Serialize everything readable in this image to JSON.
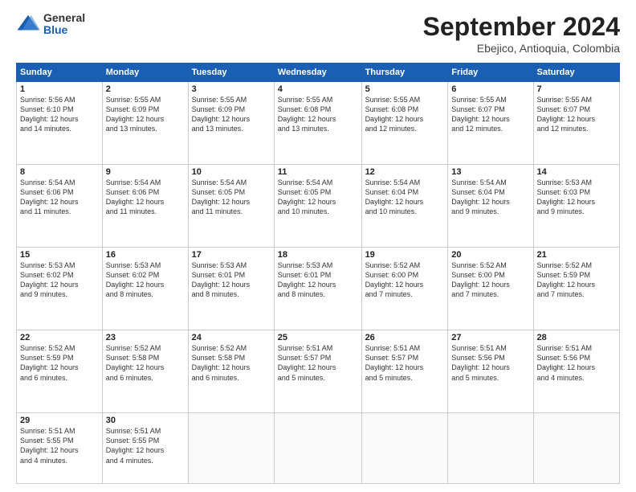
{
  "logo": {
    "general": "General",
    "blue": "Blue"
  },
  "header": {
    "month": "September 2024",
    "location": "Ebejico, Antioquia, Colombia"
  },
  "weekdays": [
    "Sunday",
    "Monday",
    "Tuesday",
    "Wednesday",
    "Thursday",
    "Friday",
    "Saturday"
  ],
  "weeks": [
    [
      {
        "day": "1",
        "info": "Sunrise: 5:56 AM\nSunset: 6:10 PM\nDaylight: 12 hours\nand 14 minutes."
      },
      {
        "day": "2",
        "info": "Sunrise: 5:55 AM\nSunset: 6:09 PM\nDaylight: 12 hours\nand 13 minutes."
      },
      {
        "day": "3",
        "info": "Sunrise: 5:55 AM\nSunset: 6:09 PM\nDaylight: 12 hours\nand 13 minutes."
      },
      {
        "day": "4",
        "info": "Sunrise: 5:55 AM\nSunset: 6:08 PM\nDaylight: 12 hours\nand 13 minutes."
      },
      {
        "day": "5",
        "info": "Sunrise: 5:55 AM\nSunset: 6:08 PM\nDaylight: 12 hours\nand 12 minutes."
      },
      {
        "day": "6",
        "info": "Sunrise: 5:55 AM\nSunset: 6:07 PM\nDaylight: 12 hours\nand 12 minutes."
      },
      {
        "day": "7",
        "info": "Sunrise: 5:55 AM\nSunset: 6:07 PM\nDaylight: 12 hours\nand 12 minutes."
      }
    ],
    [
      {
        "day": "8",
        "info": "Sunrise: 5:54 AM\nSunset: 6:06 PM\nDaylight: 12 hours\nand 11 minutes."
      },
      {
        "day": "9",
        "info": "Sunrise: 5:54 AM\nSunset: 6:06 PM\nDaylight: 12 hours\nand 11 minutes."
      },
      {
        "day": "10",
        "info": "Sunrise: 5:54 AM\nSunset: 6:05 PM\nDaylight: 12 hours\nand 11 minutes."
      },
      {
        "day": "11",
        "info": "Sunrise: 5:54 AM\nSunset: 6:05 PM\nDaylight: 12 hours\nand 10 minutes."
      },
      {
        "day": "12",
        "info": "Sunrise: 5:54 AM\nSunset: 6:04 PM\nDaylight: 12 hours\nand 10 minutes."
      },
      {
        "day": "13",
        "info": "Sunrise: 5:54 AM\nSunset: 6:04 PM\nDaylight: 12 hours\nand 9 minutes."
      },
      {
        "day": "14",
        "info": "Sunrise: 5:53 AM\nSunset: 6:03 PM\nDaylight: 12 hours\nand 9 minutes."
      }
    ],
    [
      {
        "day": "15",
        "info": "Sunrise: 5:53 AM\nSunset: 6:02 PM\nDaylight: 12 hours\nand 9 minutes."
      },
      {
        "day": "16",
        "info": "Sunrise: 5:53 AM\nSunset: 6:02 PM\nDaylight: 12 hours\nand 8 minutes."
      },
      {
        "day": "17",
        "info": "Sunrise: 5:53 AM\nSunset: 6:01 PM\nDaylight: 12 hours\nand 8 minutes."
      },
      {
        "day": "18",
        "info": "Sunrise: 5:53 AM\nSunset: 6:01 PM\nDaylight: 12 hours\nand 8 minutes."
      },
      {
        "day": "19",
        "info": "Sunrise: 5:52 AM\nSunset: 6:00 PM\nDaylight: 12 hours\nand 7 minutes."
      },
      {
        "day": "20",
        "info": "Sunrise: 5:52 AM\nSunset: 6:00 PM\nDaylight: 12 hours\nand 7 minutes."
      },
      {
        "day": "21",
        "info": "Sunrise: 5:52 AM\nSunset: 5:59 PM\nDaylight: 12 hours\nand 7 minutes."
      }
    ],
    [
      {
        "day": "22",
        "info": "Sunrise: 5:52 AM\nSunset: 5:59 PM\nDaylight: 12 hours\nand 6 minutes."
      },
      {
        "day": "23",
        "info": "Sunrise: 5:52 AM\nSunset: 5:58 PM\nDaylight: 12 hours\nand 6 minutes."
      },
      {
        "day": "24",
        "info": "Sunrise: 5:52 AM\nSunset: 5:58 PM\nDaylight: 12 hours\nand 6 minutes."
      },
      {
        "day": "25",
        "info": "Sunrise: 5:51 AM\nSunset: 5:57 PM\nDaylight: 12 hours\nand 5 minutes."
      },
      {
        "day": "26",
        "info": "Sunrise: 5:51 AM\nSunset: 5:57 PM\nDaylight: 12 hours\nand 5 minutes."
      },
      {
        "day": "27",
        "info": "Sunrise: 5:51 AM\nSunset: 5:56 PM\nDaylight: 12 hours\nand 5 minutes."
      },
      {
        "day": "28",
        "info": "Sunrise: 5:51 AM\nSunset: 5:56 PM\nDaylight: 12 hours\nand 4 minutes."
      }
    ],
    [
      {
        "day": "29",
        "info": "Sunrise: 5:51 AM\nSunset: 5:55 PM\nDaylight: 12 hours\nand 4 minutes."
      },
      {
        "day": "30",
        "info": "Sunrise: 5:51 AM\nSunset: 5:55 PM\nDaylight: 12 hours\nand 4 minutes."
      },
      {
        "day": "",
        "info": ""
      },
      {
        "day": "",
        "info": ""
      },
      {
        "day": "",
        "info": ""
      },
      {
        "day": "",
        "info": ""
      },
      {
        "day": "",
        "info": ""
      }
    ]
  ]
}
